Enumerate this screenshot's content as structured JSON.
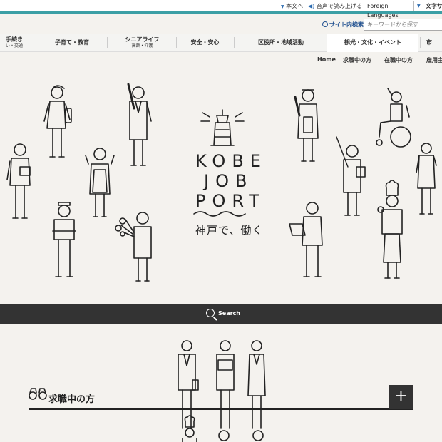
{
  "utility": {
    "honbun": "本文へ",
    "onsei": "音声で読み上げる",
    "foreign_languages": "Foreign Languages",
    "moji_size": "文字サ"
  },
  "search": {
    "label": "サイト内検索",
    "placeholder": "キーワードから探す"
  },
  "gnav": {
    "items": [
      {
        "label": "手続き",
        "sub": "い・交通"
      },
      {
        "label": "子育て・教育"
      },
      {
        "label": "シニアライフ",
        "sub": "高齢・介護"
      },
      {
        "label": "安全・安心"
      },
      {
        "label": "区役所・地域活動"
      },
      {
        "label": "観光・文化・イベント"
      },
      {
        "label": "市"
      }
    ]
  },
  "subnav": {
    "items": [
      "Home",
      "求職中の方",
      "在職中の方",
      "雇用主"
    ]
  },
  "hero": {
    "logo_lines": [
      "KOBE",
      "JOB",
      "PORT"
    ],
    "tagline": "神戸で、働く"
  },
  "search_band": {
    "label": "Search"
  },
  "section": {
    "title": "求職中の方",
    "toggle": "+"
  },
  "colors": {
    "accent": "#3b9fa5",
    "dark_band": "#333333",
    "background": "#f4f2ee",
    "link_blue": "#1f4f8f"
  }
}
